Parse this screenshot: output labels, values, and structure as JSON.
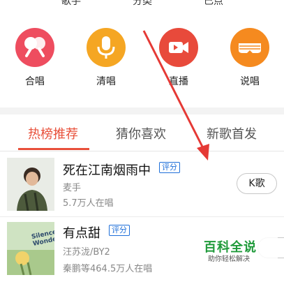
{
  "top_labels": [
    "歌手",
    "分类",
    "已点"
  ],
  "categories": [
    {
      "label": "合唱",
      "icon": "duet-icon",
      "color": "#ee4d5f"
    },
    {
      "label": "清唱",
      "icon": "microphone-icon",
      "color": "#f5a623"
    },
    {
      "label": "直播",
      "icon": "video-camera-icon",
      "color": "#e84a3b"
    },
    {
      "label": "说唱",
      "icon": "shutter-shades-icon",
      "color": "#f58a1f"
    }
  ],
  "tabs": [
    {
      "label": "热榜推荐",
      "active": true
    },
    {
      "label": "猜你喜欢",
      "active": false
    },
    {
      "label": "新歌首发",
      "active": false
    }
  ],
  "songs": [
    {
      "title": "死在江南烟雨中",
      "badge": "评分",
      "singer": "麦手",
      "listeners": "5.7万人在唱",
      "button": "K歌"
    },
    {
      "title": "有点甜",
      "badge": "评分",
      "singer": "汪苏泷/BY2",
      "listeners": "秦鹏等464.5万人在唱",
      "cover_text": "Silence Wonderland"
    }
  ],
  "watermark": {
    "main": "百科全说",
    "sub": "助你轻松解决"
  },
  "colors": {
    "accent": "#e8503a",
    "badge": "#1e6fd9",
    "watermark": "#1f9a3a"
  }
}
